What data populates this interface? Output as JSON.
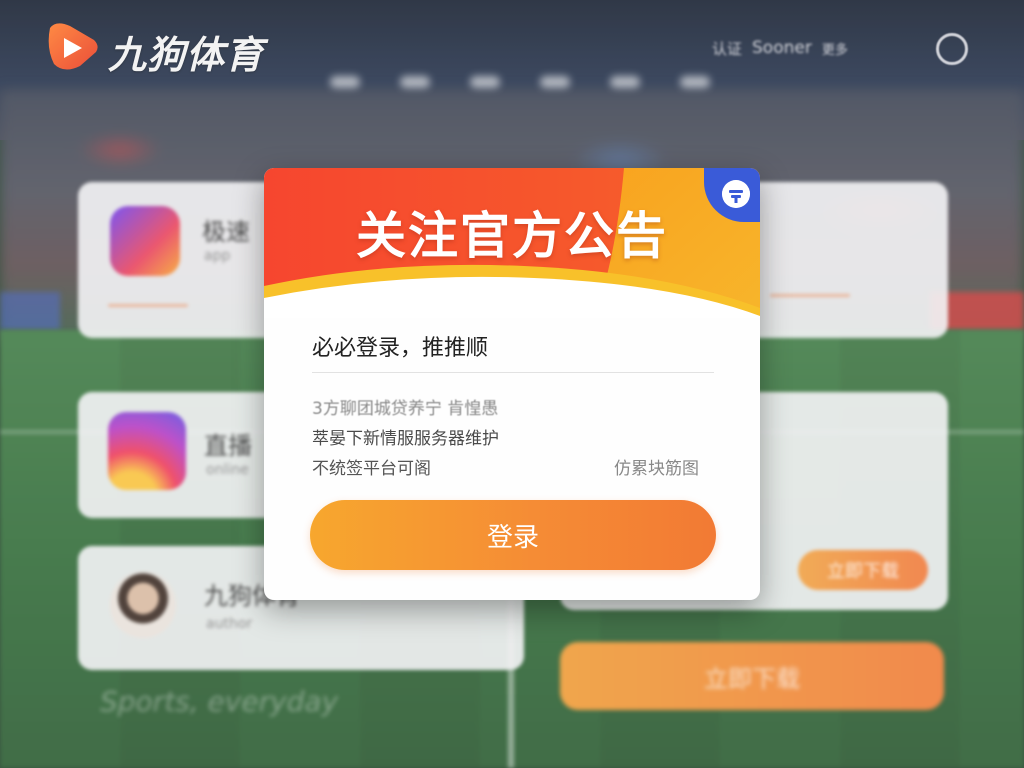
{
  "header": {
    "brand": "九狗体育",
    "nav_text_1": "认证",
    "nav_text_2": "Sooner",
    "nav_text_3": "更多",
    "logo_icon": "play-logo-icon",
    "user_icon": "user-circle-icon"
  },
  "background_cards": [
    {
      "title": "极速",
      "subtitle": "app",
      "icon": "rocket-app-icon"
    },
    {
      "title": "直播",
      "subtitle": "online",
      "icon": "camera-app-icon"
    },
    {
      "title": "九狗体育",
      "subtitle": "author",
      "icon": "avatar"
    }
  ],
  "background": {
    "pill_label": "立即下载",
    "bottom_button_label": "立即下载",
    "caption": "Sports, everyday"
  },
  "modal": {
    "title": "关注官方公告",
    "badge_icon": "megaphone-icon",
    "headline": "必必登录，推推顺",
    "notice_line_1": "3方聊团城贷养宁 肯惶愚",
    "notice_line_2": "萃晏下新情服服务器维护",
    "notice_line_3": "不统签平台可阁",
    "side_link": "仿累块筋图",
    "login_button": "登录"
  },
  "colors": {
    "header_orange": "#f6562f",
    "header_yellow": "#f9a31f",
    "badge_blue": "#3a5bd8",
    "button_orange": "#f58c35"
  }
}
